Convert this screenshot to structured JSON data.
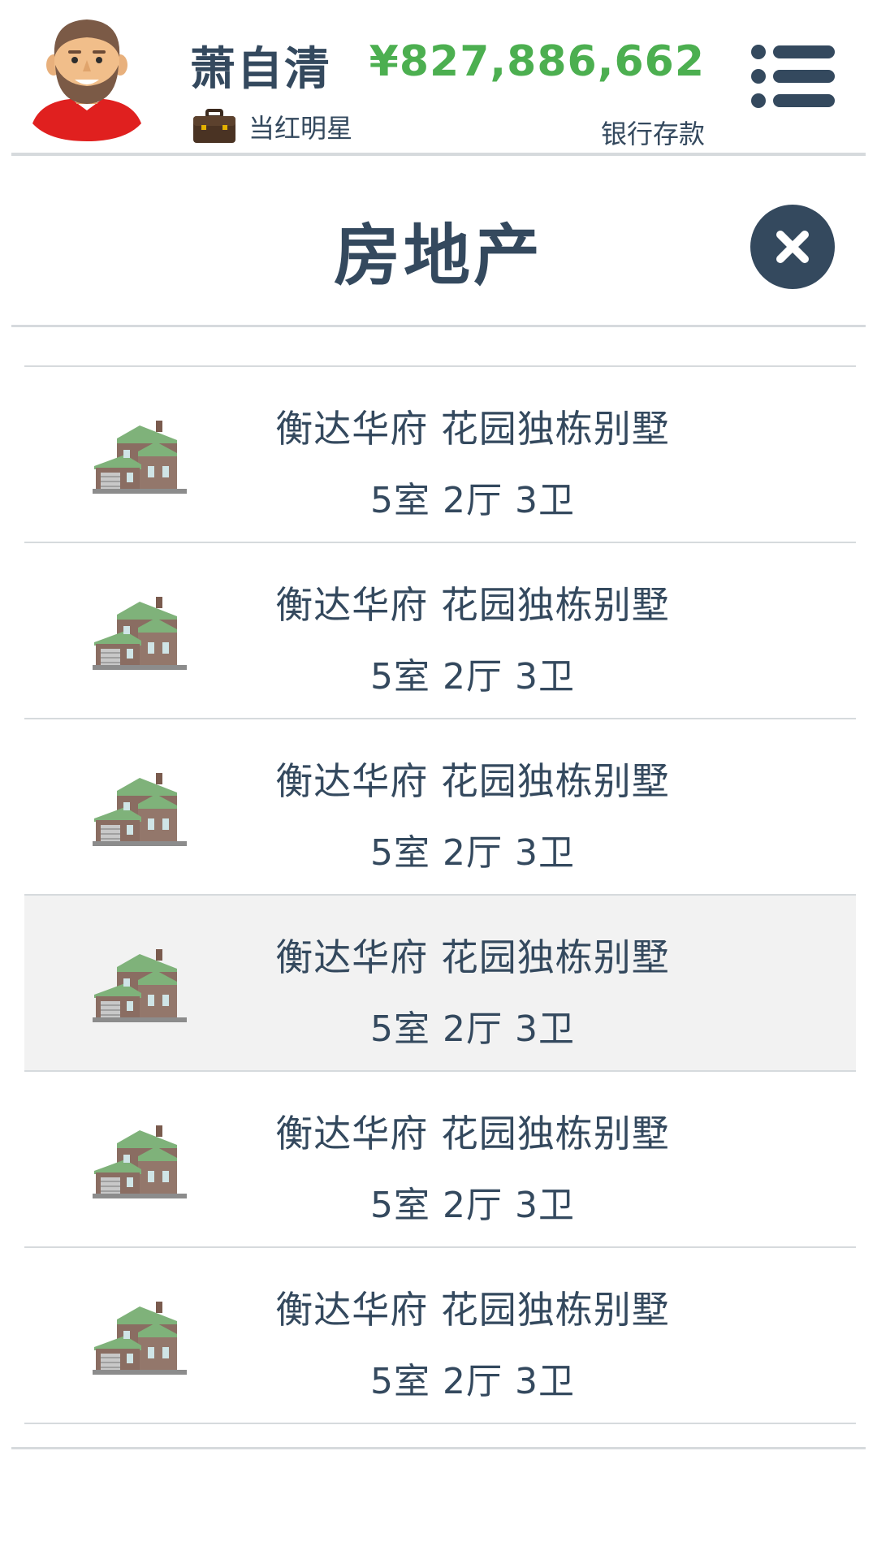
{
  "header": {
    "player_name": "萧自清",
    "job_title": "当红明星",
    "money": "¥827,886,662",
    "money_label": "银行存款",
    "money_color": "#4caf50"
  },
  "page": {
    "title": "房地产"
  },
  "icons": {
    "avatar": "bearded-man-avatar-icon",
    "job": "briefcase-icon",
    "menu": "list-menu-icon",
    "close": "close-icon",
    "property": "house-icon"
  },
  "properties": [
    {
      "title": "衡达华府 花园独栋别墅",
      "rooms": "5室 2厅 3卫",
      "highlighted": false
    },
    {
      "title": "衡达华府 花园独栋别墅",
      "rooms": "5室 2厅 3卫",
      "highlighted": false
    },
    {
      "title": "衡达华府 花园独栋别墅",
      "rooms": "5室 2厅 3卫",
      "highlighted": false
    },
    {
      "title": "衡达华府 花园独栋别墅",
      "rooms": "5室 2厅 3卫",
      "highlighted": true
    },
    {
      "title": "衡达华府 花园独栋别墅",
      "rooms": "5室 2厅 3卫",
      "highlighted": false
    },
    {
      "title": "衡达华府 花园独栋别墅",
      "rooms": "5室 2厅 3卫",
      "highlighted": false
    }
  ]
}
